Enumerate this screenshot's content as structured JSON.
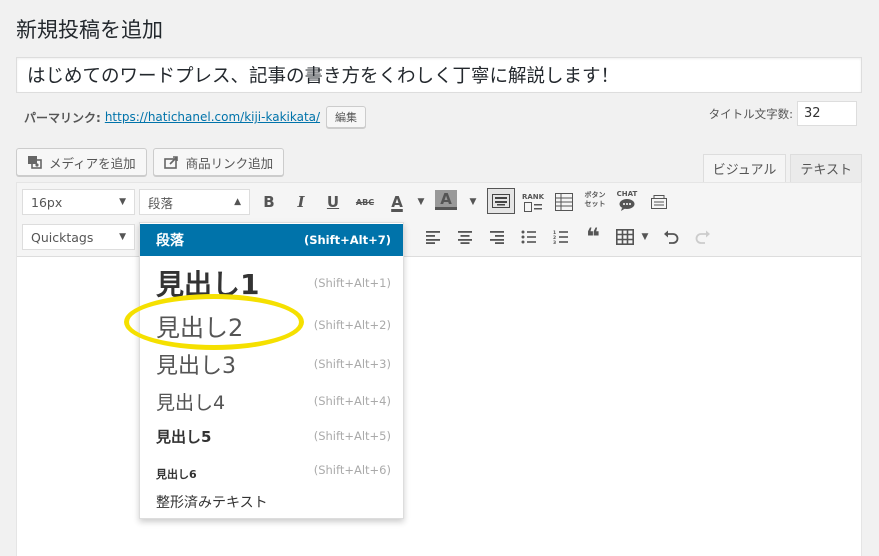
{
  "page": {
    "title": "新規投稿を追加"
  },
  "post": {
    "title": "はじめてのワードプレス、記事の書き方をくわしく丁寧に解説します！"
  },
  "permalink": {
    "label": "パーマリンク:",
    "url": "https://hatichanel.com/kiji-kakikata/",
    "edit_label": "編集"
  },
  "title_count": {
    "label": "タイトル文字数:",
    "value": "32"
  },
  "media": {
    "add_media": "メディアを追加",
    "add_product_link": "商品リンク追加"
  },
  "tabs": {
    "visual": "ビジュアル",
    "text": "テキスト"
  },
  "toolbar": {
    "font_size": "16px",
    "format": "段落",
    "quicktags": "Quicktags",
    "bold": "B",
    "italic": "I",
    "underline": "U",
    "strike": "ABC",
    "text_color": "A",
    "bg_color": "A",
    "rank_label": "RANK",
    "button_label_1": "ボタン",
    "button_label_2": "セット",
    "chat_label": "CHAT"
  },
  "format_menu": [
    {
      "label": "段落",
      "shortcut": "(Shift+Alt+7)"
    },
    {
      "label": "見出し1",
      "shortcut": "(Shift+Alt+1)"
    },
    {
      "label": "見出し2",
      "shortcut": "(Shift+Alt+2)"
    },
    {
      "label": "見出し3",
      "shortcut": "(Shift+Alt+3)"
    },
    {
      "label": "見出し4",
      "shortcut": "(Shift+Alt+4)"
    },
    {
      "label": "見出し5",
      "shortcut": "(Shift+Alt+5)"
    },
    {
      "label": "見出し6",
      "shortcut": "(Shift+Alt+6)"
    },
    {
      "label": "整形済みテキスト",
      "shortcut": ""
    }
  ],
  "colors": {
    "accent": "#0073aa",
    "highlight": "#f5e000"
  }
}
